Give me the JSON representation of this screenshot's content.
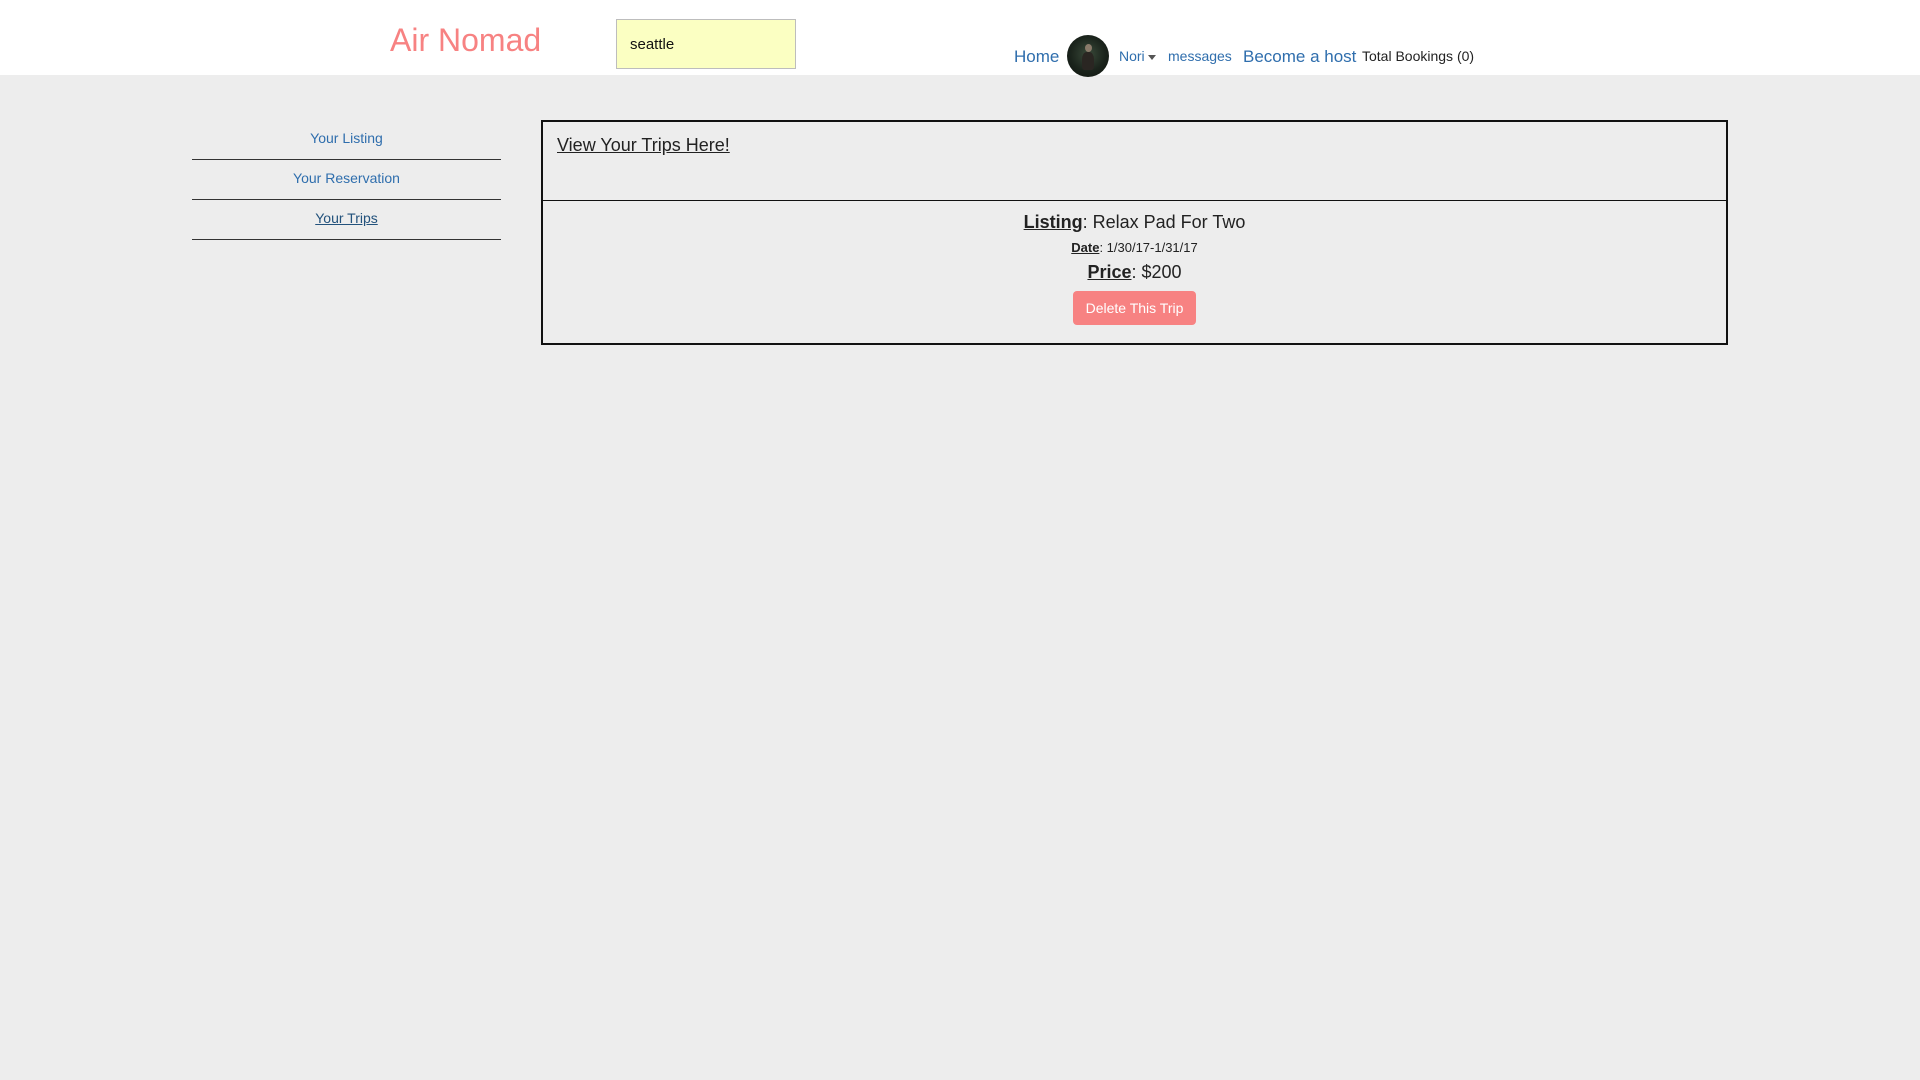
{
  "header": {
    "logo": "Air Nomad",
    "search": {
      "value": "seattle",
      "placeholder": ""
    },
    "nav": {
      "home": "Home",
      "user": "Nori",
      "messages": "messages",
      "become_host": "Become a host",
      "total_bookings": "Total Bookings (0)"
    }
  },
  "sidebar": {
    "items": [
      {
        "label": "Your Listing"
      },
      {
        "label": "Your Reservation"
      },
      {
        "label": "Your Trips"
      }
    ]
  },
  "panel": {
    "title": "View Your Trips Here!",
    "trip": {
      "listing_label": "Listing",
      "listing_value": ": Relax Pad For Two",
      "date_label": "Date",
      "date_value": ": 1/30/17-1/31/17",
      "price_label": "Price",
      "price_value": ": $200",
      "delete_button": "Delete This Trip"
    }
  },
  "colors": {
    "brand": "#f78282",
    "link": "#2f6ead",
    "background": "#ededed",
    "search_bg": "#fbffc2"
  }
}
